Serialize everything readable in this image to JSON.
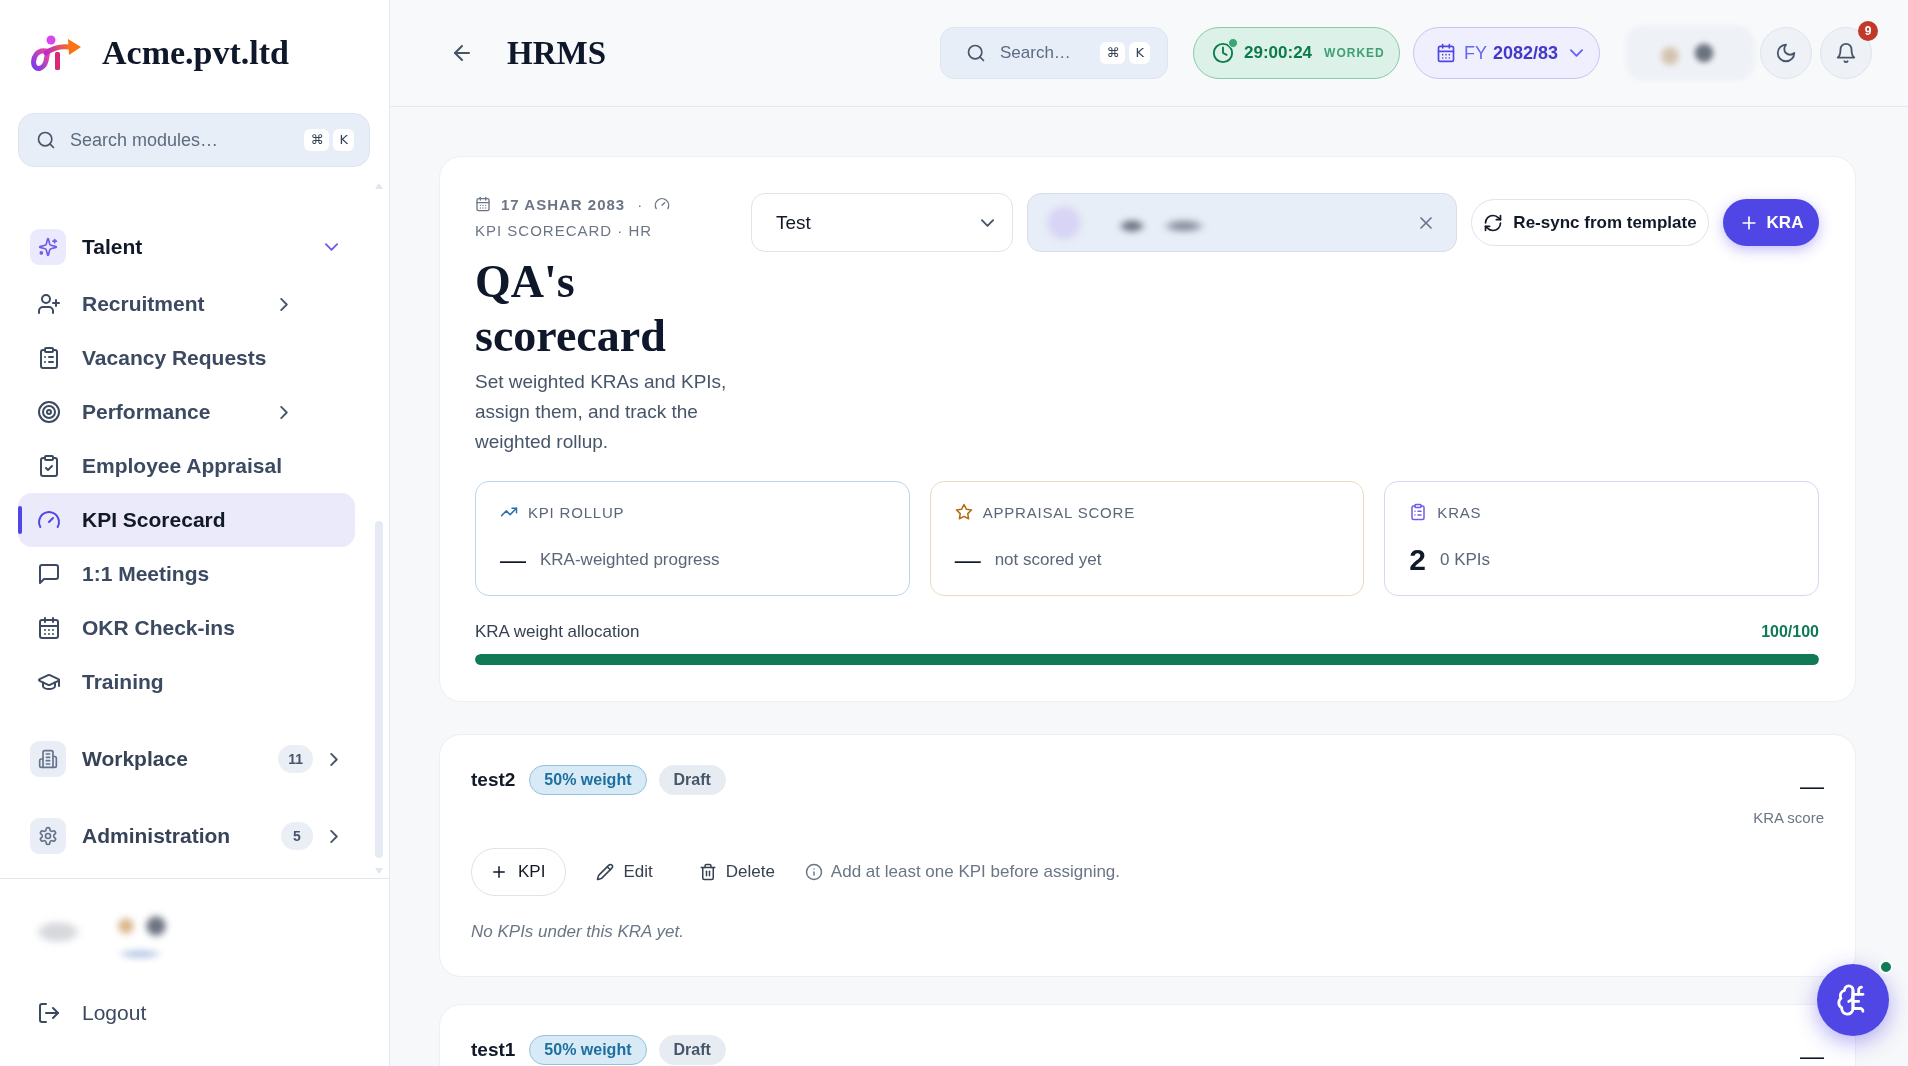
{
  "sidebar": {
    "brand": "Acme.pvt.ltd",
    "search": {
      "placeholder": "Search modules…",
      "keys": [
        "⌘",
        "K"
      ]
    },
    "groups": [
      {
        "label": "Talent",
        "expanded": true,
        "children": [
          {
            "label": "Recruitment",
            "selected": false,
            "expandable": true
          },
          {
            "label": "Vacancy Requests",
            "selected": false,
            "expandable": false
          },
          {
            "label": "Performance",
            "selected": false,
            "expandable": true
          },
          {
            "label": "Employee Appraisal",
            "selected": false,
            "expandable": false
          },
          {
            "label": "KPI Scorecard",
            "selected": true,
            "expandable": false
          },
          {
            "label": "1:1 Meetings",
            "selected": false,
            "expandable": false
          },
          {
            "label": "OKR Check-ins",
            "selected": false,
            "expandable": false
          },
          {
            "label": "Training",
            "selected": false,
            "expandable": false
          }
        ]
      },
      {
        "label": "Workplace",
        "count": "11",
        "expanded": false
      },
      {
        "label": "Administration",
        "count": "5",
        "expanded": false
      }
    ],
    "logout": "Logout"
  },
  "header": {
    "title": "HRMS",
    "search": {
      "placeholder": "Search…",
      "keys": [
        "⌘",
        "K"
      ]
    },
    "timer": {
      "value": "29:00:24",
      "label": "WORKED",
      "running": true
    },
    "fiscal_year": {
      "prefix": "FY",
      "value": "2082/83"
    },
    "notifications": {
      "count": "9"
    }
  },
  "scorecard": {
    "date": "17 ASHAR 2083",
    "separator": "·",
    "breadcrumb": "KPI SCORECARD · HR",
    "title": "QA's scorecard",
    "description": "Set weighted KRAs and KPIs, assign them, and track the weighted rollup.",
    "template_select": {
      "value": "Test"
    },
    "resync_button": "Re-sync from template",
    "add_kra_button": "KRA",
    "stats": [
      {
        "kind": "rollup",
        "label": "KPI ROLLUP",
        "value": "—",
        "caption": "KRA-weighted progress"
      },
      {
        "kind": "appraisal",
        "label": "APPRAISAL SCORE",
        "value": "—",
        "caption": "not scored yet"
      },
      {
        "kind": "count",
        "label": "KRAS",
        "value": "2",
        "caption": "0 KPIs"
      }
    ],
    "allocation": {
      "label": "KRA weight allocation",
      "reading": "100/100",
      "level": 1
    }
  },
  "kras": [
    {
      "name": "test2",
      "weight": "50% weight",
      "status": "Draft",
      "score": "—",
      "score_label": "KRA score",
      "add_kpi_button": "KPI",
      "edit_button": "Edit",
      "delete_button": "Delete",
      "hint": "Add at least one KPI before assigning.",
      "empty_message": "No KPIs under this KRA yet."
    },
    {
      "name": "test1",
      "weight": "50% weight",
      "status": "Draft",
      "score": "—"
    }
  ]
}
